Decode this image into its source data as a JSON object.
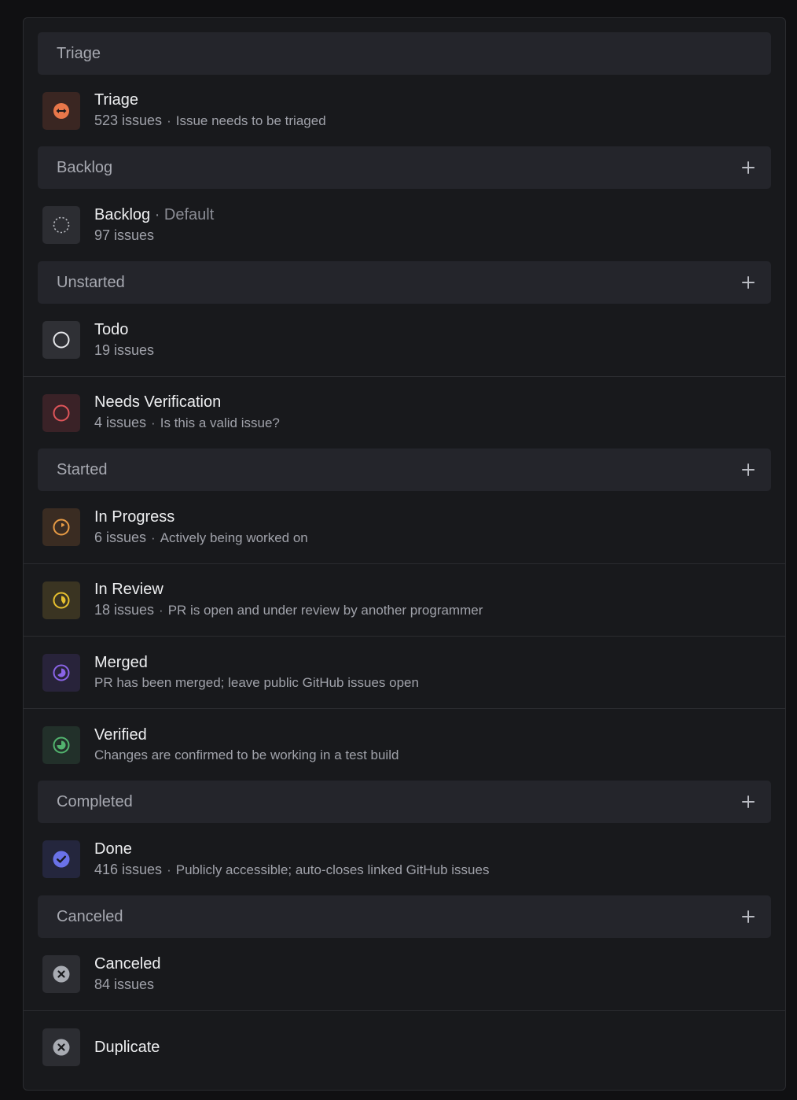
{
  "groups": [
    {
      "title": "Triage",
      "has_add": false
    },
    {
      "title": "Backlog",
      "has_add": true
    },
    {
      "title": "Unstarted",
      "has_add": true
    },
    {
      "title": "Started",
      "has_add": true
    },
    {
      "title": "Completed",
      "has_add": true
    },
    {
      "title": "Canceled",
      "has_add": true
    }
  ],
  "statuses": {
    "triage": {
      "name": "Triage",
      "count": "523 issues",
      "dot": "·",
      "description": "Issue needs to be triaged",
      "icon": "triage-icon",
      "color": "#e8774a"
    },
    "backlog": {
      "name": "Backlog",
      "suffix": "· Default",
      "count": "97 issues",
      "icon": "backlog-dashed-circle-icon",
      "color": "#b5b7bd"
    },
    "todo": {
      "name": "Todo",
      "count": "19 issues",
      "icon": "todo-circle-icon",
      "color": "#e6e7ea"
    },
    "needs_verification": {
      "name": "Needs Verification",
      "count": "4 issues",
      "dot": "·",
      "description": "Is this a valid issue?",
      "icon": "red-circle-icon",
      "color": "#e0555a"
    },
    "in_progress": {
      "name": "In Progress",
      "count": "6 issues",
      "dot": "·",
      "description": "Actively being worked on",
      "icon": "progress-icon",
      "color": "#e79b45"
    },
    "in_review": {
      "name": "In Review",
      "count": "18 issues",
      "dot": "·",
      "description": "PR is open and under review by another programmer",
      "icon": "review-icon",
      "color": "#e7c02f"
    },
    "merged": {
      "name": "Merged",
      "description": "PR has been merged; leave public GitHub issues open",
      "icon": "merged-icon",
      "color": "#8a64e6"
    },
    "verified": {
      "name": "Verified",
      "description": "Changes are confirmed to be working in a test build",
      "icon": "verified-icon",
      "color": "#52b36e"
    },
    "done": {
      "name": "Done",
      "count": "416 issues",
      "dot": "·",
      "description": "Publicly accessible; auto-closes linked GitHub issues",
      "icon": "done-check-icon",
      "color": "#6a72e8"
    },
    "canceled": {
      "name": "Canceled",
      "count": "84 issues",
      "icon": "canceled-x-icon",
      "color": "#a8abb2"
    },
    "duplicate": {
      "name": "Duplicate",
      "icon": "duplicate-x-icon",
      "color": "#a8abb2"
    }
  }
}
